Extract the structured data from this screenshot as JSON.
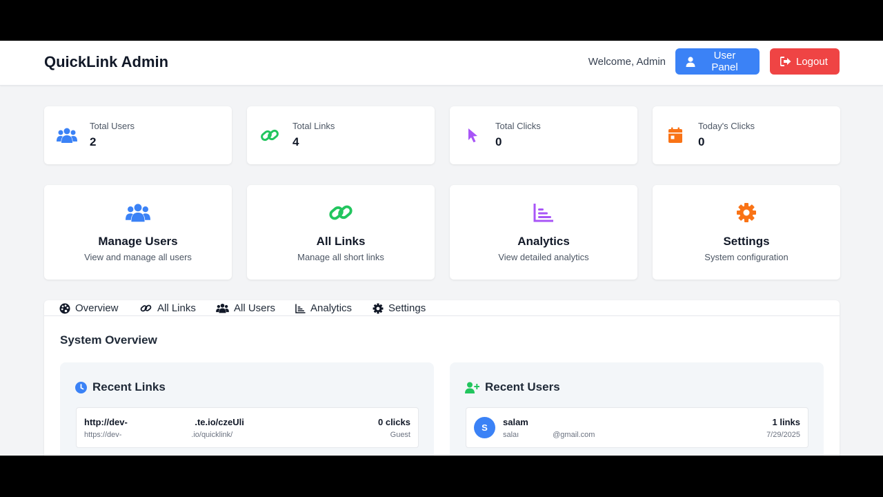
{
  "header": {
    "brand": "QuickLink Admin",
    "welcome": "Welcome, Admin",
    "user_panel_label": "User Panel",
    "logout_label": "Logout"
  },
  "stats": [
    {
      "label": "Total Users",
      "value": "2",
      "icon": "users-icon",
      "color": "#3b82f6"
    },
    {
      "label": "Total Links",
      "value": "4",
      "icon": "link-icon",
      "color": "#22c55e"
    },
    {
      "label": "Total Clicks",
      "value": "0",
      "icon": "cursor-icon",
      "color": "#a855f7"
    },
    {
      "label": "Today's Clicks",
      "value": "0",
      "icon": "calendar-icon",
      "color": "#f97316"
    }
  ],
  "actions": [
    {
      "title": "Manage Users",
      "desc": "View and manage all users",
      "icon": "users-icon",
      "color": "#3b82f6"
    },
    {
      "title": "All Links",
      "desc": "Manage all short links",
      "icon": "link-icon",
      "color": "#22c55e"
    },
    {
      "title": "Analytics",
      "desc": "View detailed analytics",
      "icon": "chart-icon",
      "color": "#a855f7"
    },
    {
      "title": "Settings",
      "desc": "System configuration",
      "icon": "gear-icon",
      "color": "#f97316"
    }
  ],
  "tabs": [
    {
      "label": "Overview",
      "icon": "palette-icon"
    },
    {
      "label": "All Links",
      "icon": "link-icon"
    },
    {
      "label": "All Users",
      "icon": "users-icon"
    },
    {
      "label": "Analytics",
      "icon": "chart-icon"
    },
    {
      "label": "Settings",
      "icon": "gear-icon"
    }
  ],
  "overview": {
    "title": "System Overview",
    "recent_links": {
      "title": "Recent Links",
      "items": [
        {
          "short": "http://dev-                           .te.io/czeUli",
          "original": "https://dev-                                 .io/quicklink/",
          "clicks": "0 clicks",
          "owner": "Guest"
        }
      ]
    },
    "recent_users": {
      "title": "Recent Users",
      "items": [
        {
          "initial": "S",
          "name": "salam",
          "email": "salaı                @gmail.com",
          "links": "1 links",
          "date": "7/29/2025"
        }
      ]
    }
  },
  "colors": {
    "primary": "#3b82f6",
    "danger": "#ef4444",
    "success": "#22c55e",
    "purple": "#a855f7",
    "orange": "#f97316"
  }
}
